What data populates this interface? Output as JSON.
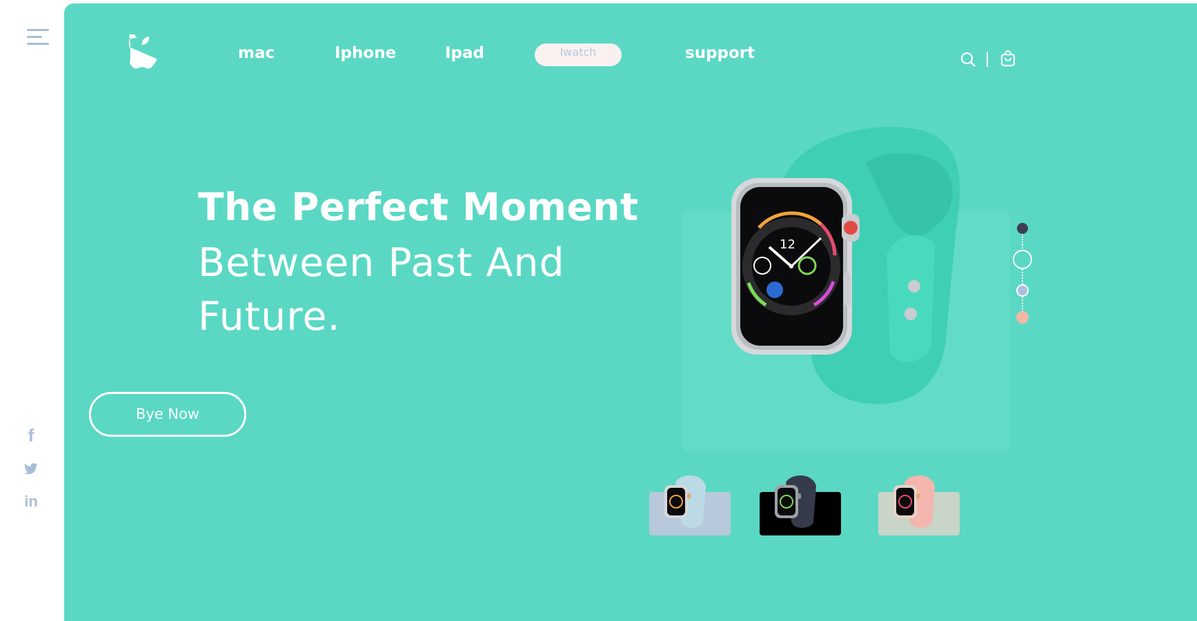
{
  "sidebar": {
    "menu_icon": "hamburger-menu-icon",
    "social": [
      {
        "name": "facebook-icon",
        "glyph": "f"
      },
      {
        "name": "twitter-icon",
        "glyph": ""
      },
      {
        "name": "linkedin-icon",
        "glyph": "in"
      }
    ]
  },
  "nav": {
    "logo": "apple-logo-icon",
    "items": [
      {
        "label": "mac"
      },
      {
        "label": "Iphone"
      },
      {
        "label": "Ipad"
      },
      {
        "label": "Iwatch",
        "active": true
      },
      {
        "label": "support"
      }
    ],
    "search_icon": "search-icon",
    "cart_icon": "shopping-bag-icon"
  },
  "hero": {
    "line1": "The Perfect Moment",
    "line2": "Between Past And",
    "line3": "Future.",
    "cta": "Bye Now"
  },
  "color_options": [
    {
      "name": "dark",
      "color": "#3d4052"
    },
    {
      "name": "teal",
      "color": "#5ad8c4",
      "selected": true
    },
    {
      "name": "blue",
      "color": "#a9bfe0"
    },
    {
      "name": "pink",
      "color": "#f3b8a5"
    }
  ],
  "thumbnails": [
    {
      "name": "blue-band-watch",
      "bg": "#b7c9da",
      "band": "#bcd9e6"
    },
    {
      "name": "dark-band-watch",
      "bg": "#000000",
      "band": "#363b4c"
    },
    {
      "name": "pink-band-watch",
      "bg": "#c8d5c7",
      "band": "#f4b6ae"
    }
  ],
  "colors": {
    "panel": "#5ad8c4",
    "accent_text": "#ffffff",
    "pill_bg": "#fbf0f0",
    "sidebar_icon": "#a9bdd6"
  }
}
